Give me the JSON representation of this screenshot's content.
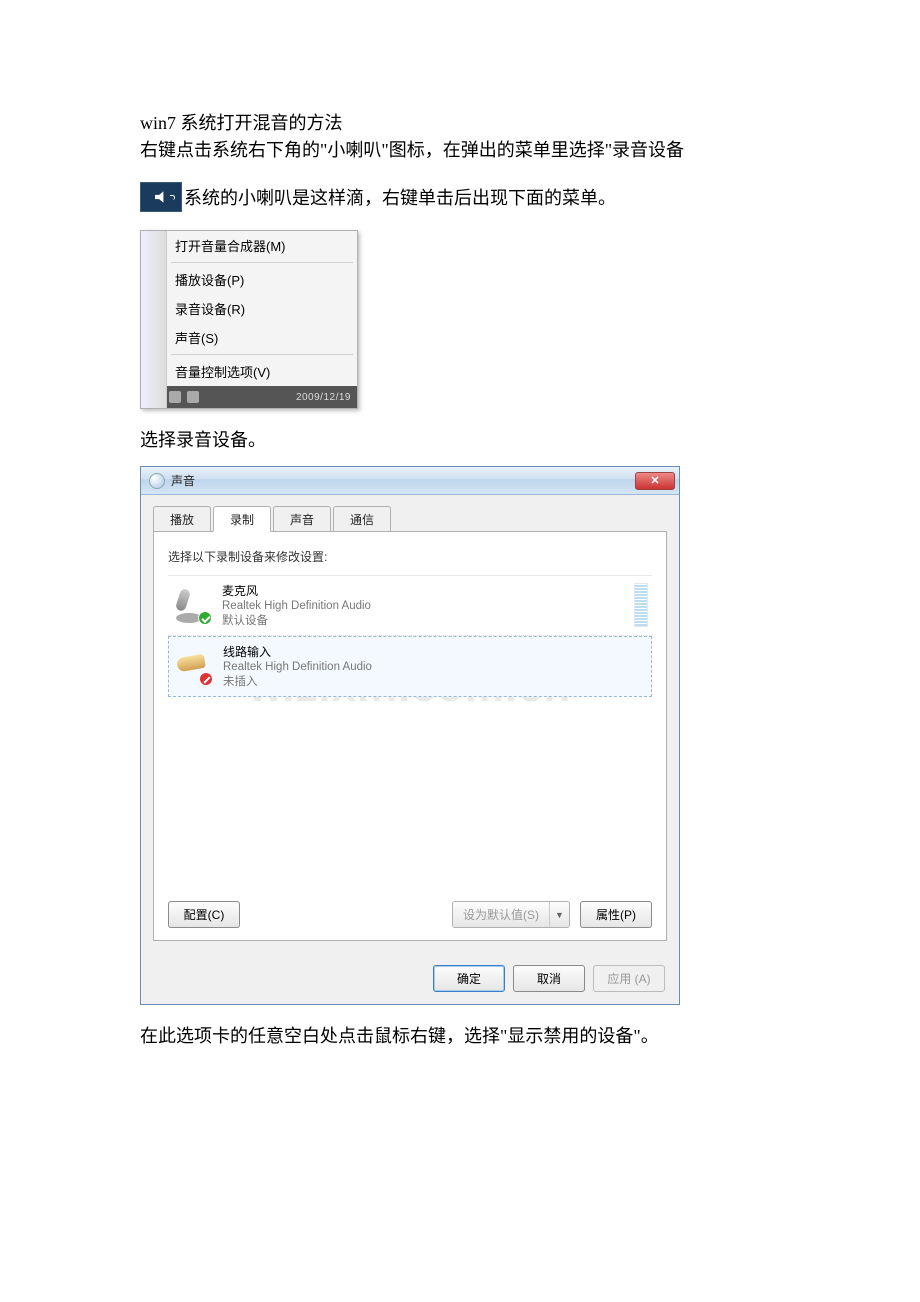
{
  "article": {
    "title": "win7 系统打开混音的方法",
    "p1": "右键点击系统右下角的\"小喇叭\"图标，在弹出的菜单里选择\"录音设备",
    "p2_after_icon": "系统的小喇叭是这样滴，右键单击后出现下面的菜单。",
    "p3": "选择录音设备。",
    "p4": "在此选项卡的任意空白处点击鼠标右键，选择\"显示禁用的设备\"。"
  },
  "context_menu": {
    "items": [
      "打开音量合成器(M)",
      "播放设备(P)",
      "录音设备(R)",
      "声音(S)",
      "音量控制选项(V)"
    ],
    "footer_time": "2009/12/19"
  },
  "dialog": {
    "title": "声音",
    "close_label": "✕",
    "tabs": [
      "播放",
      "录制",
      "声音",
      "通信"
    ],
    "active_tab": 1,
    "panel_label": "选择以下录制设备来修改设置:",
    "devices": [
      {
        "name": "麦克风",
        "sub1": "Realtek High Definition Audio",
        "sub2": "默认设备",
        "status": "ok",
        "meter": true
      },
      {
        "name": "线路输入",
        "sub1": "Realtek High Definition Audio",
        "sub2": "未插入",
        "status": "unplugged",
        "meter": false
      }
    ],
    "watermark": "w.zixin.com.cn",
    "btn_configure": "配置(C)",
    "btn_set_default": "设为默认值(S)",
    "btn_properties": "属性(P)",
    "btn_ok": "确定",
    "btn_cancel": "取消",
    "btn_apply": "应用 (A)"
  }
}
